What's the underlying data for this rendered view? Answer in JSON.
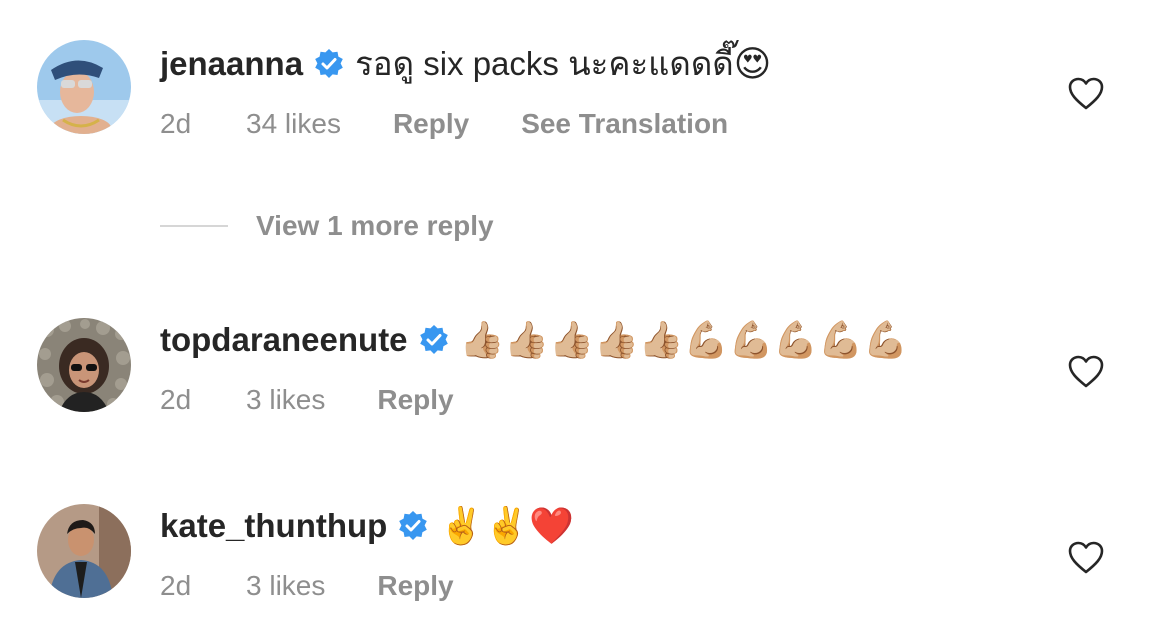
{
  "comments": [
    {
      "username": "jenaanna",
      "text": "รอดู six packs นะคะแดดดี๊",
      "emoji": "😍",
      "time": "2d",
      "likes": "34 likes",
      "reply": "Reply",
      "translate": "See Translation",
      "verified": true
    },
    {
      "username": "topdaraneenute",
      "text": "",
      "emoji": "👍🏼👍🏼👍🏼👍🏼👍🏼💪🏼💪🏼💪🏼💪🏼💪🏼",
      "time": "2d",
      "likes": "3 likes",
      "reply": "Reply",
      "verified": true
    },
    {
      "username": "kate_thunthup",
      "text": "",
      "emoji": "✌️✌️❤️",
      "time": "2d",
      "likes": "3 likes",
      "reply": "Reply",
      "verified": true
    }
  ],
  "view_replies": {
    "label": "View 1 more reply"
  },
  "colors": {
    "verified": "#3897f0",
    "meta_text": "#8e8e8e",
    "primary_text": "#262626",
    "divider": "#d6d6d6"
  },
  "icons": {
    "verified": "verified-badge-icon",
    "like": "heart-outline-icon"
  }
}
